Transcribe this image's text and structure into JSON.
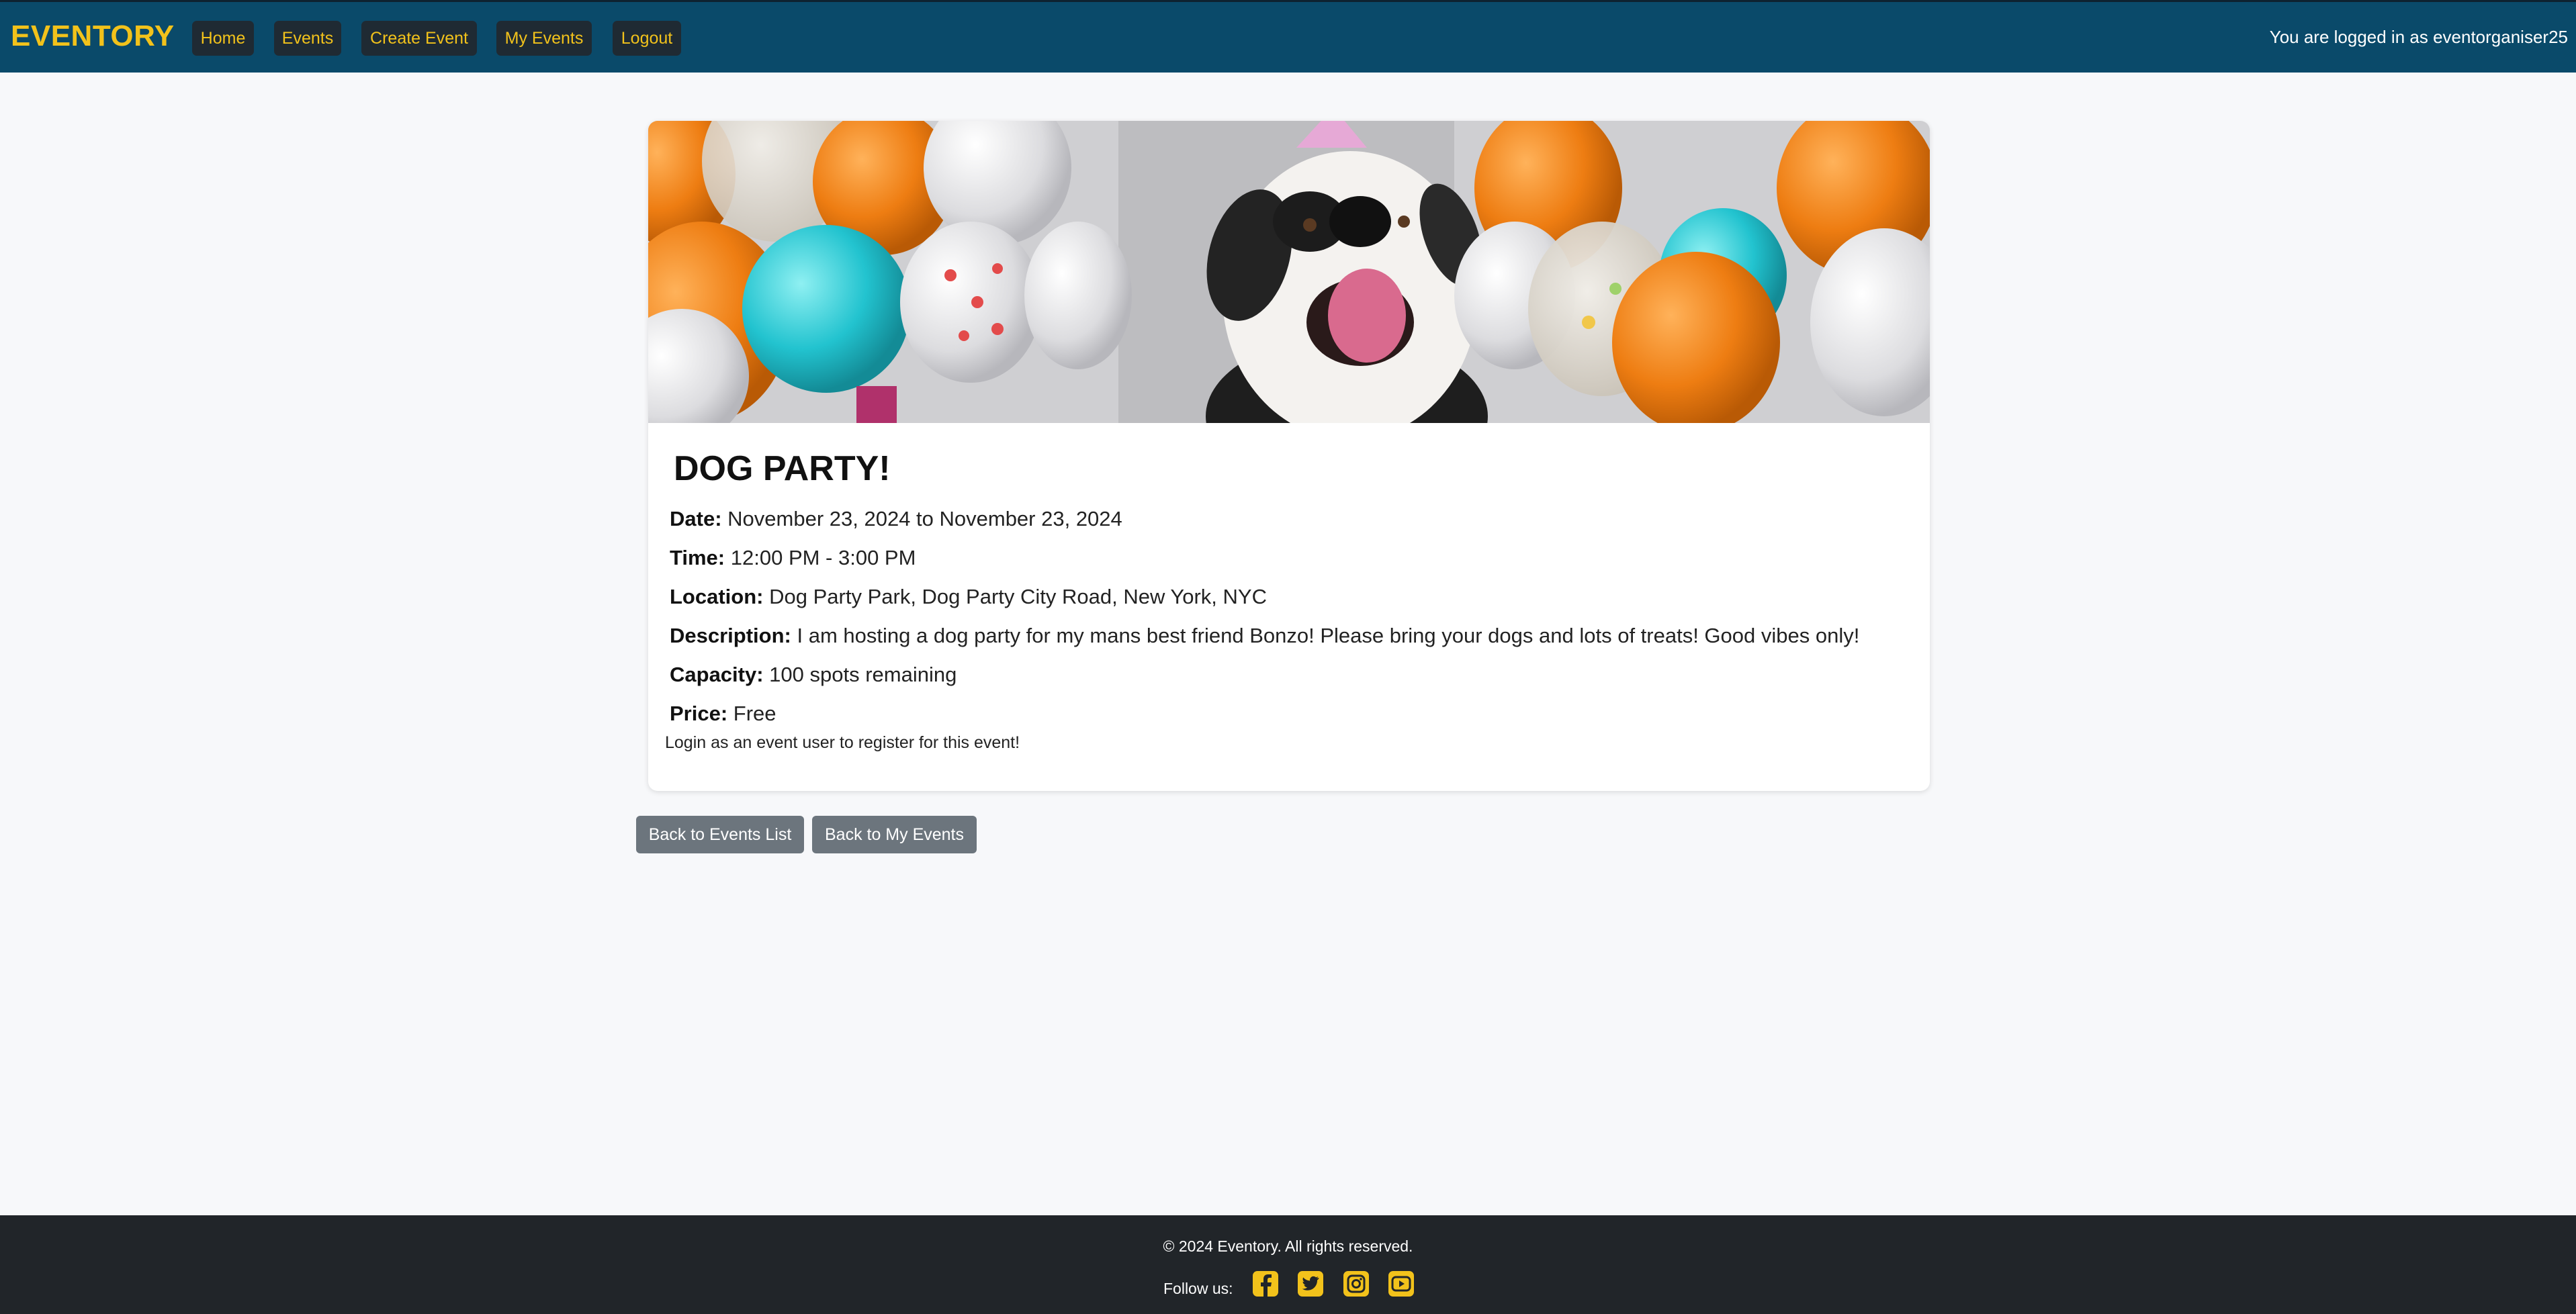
{
  "navbar": {
    "brand": "EVENTORY",
    "links": [
      {
        "label": "Home"
      },
      {
        "label": "Events"
      },
      {
        "label": "Create Event"
      },
      {
        "label": "My Events"
      },
      {
        "label": "Logout"
      }
    ],
    "login_status": "You are logged in as eventorganiser25"
  },
  "event": {
    "title": "DOG PARTY!",
    "date_label": "Date:",
    "date_value": "November 23, 2024 to November 23, 2024",
    "time_label": "Time:",
    "time_value": "12:00 PM - 3:00 PM",
    "location_label": "Location:",
    "location_value": "Dog Party Park, Dog Party City Road, New York, NYC",
    "description_label": "Description:",
    "description_value": "I am hosting a dog party for my mans best friend Bonzo! Please bring your dogs and lots of treats! Good vibes only!",
    "capacity_label": "Capacity:",
    "capacity_value": "100 spots remaining",
    "price_label": "Price:",
    "price_value": "Free",
    "register_note": "Login as an event user to register for this event!"
  },
  "actions": {
    "back_events": "Back to Events List",
    "back_my_events": "Back to My Events"
  },
  "footer": {
    "copyright": "© 2024 Eventory. All rights reserved.",
    "follow": "Follow us:",
    "social_icons": [
      "facebook-icon",
      "twitter-icon",
      "instagram-icon",
      "youtube-icon"
    ]
  },
  "colors": {
    "navbar_bg": "#0a4a6a",
    "accent": "#f2c21b",
    "nav_button_bg": "#1f2a33",
    "footer_bg": "#212529",
    "secondary_button": "#6c757d"
  }
}
